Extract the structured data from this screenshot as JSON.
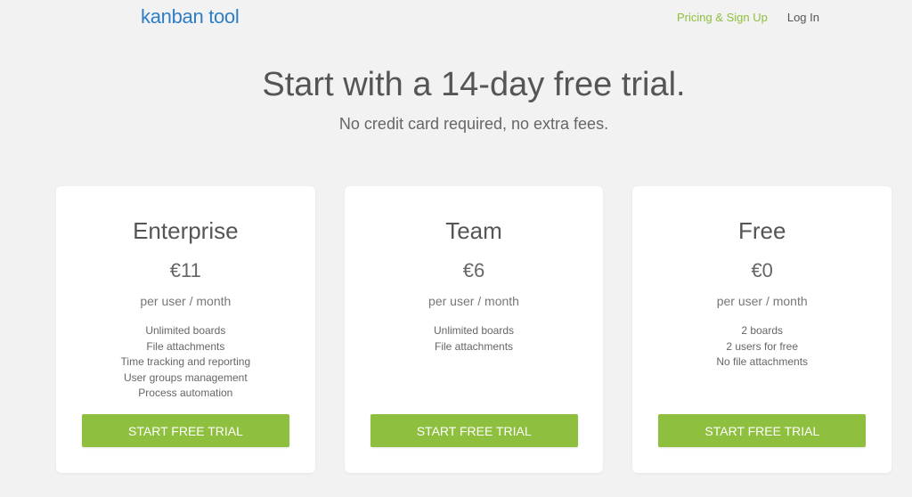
{
  "header": {
    "logo_text": "kanban tool",
    "nav": {
      "pricing_label": "Pricing & Sign Up",
      "login_label": "Log In"
    }
  },
  "hero": {
    "title": "Start with a 14-day free trial.",
    "subtitle": "No credit card required, no extra fees."
  },
  "plans": [
    {
      "name": "Enterprise",
      "price": "€11",
      "period": "per user / month",
      "features": [
        "Unlimited boards",
        "File attachments",
        "Time tracking and reporting",
        "User groups management",
        "Process automation"
      ],
      "cta_label": "START FREE TRIAL"
    },
    {
      "name": "Team",
      "price": "€6",
      "period": "per user / month",
      "features": [
        "Unlimited boards",
        "File attachments"
      ],
      "cta_label": "START FREE TRIAL"
    },
    {
      "name": "Free",
      "price": "€0",
      "period": "per user / month",
      "features": [
        "2 boards",
        "2 users for free",
        "No file attachments"
      ],
      "cta_label": "START FREE TRIAL"
    }
  ],
  "colors": {
    "brand_blue": "#2f7ec4",
    "accent_green": "#8fbf3e",
    "background": "#f2f2f2"
  }
}
